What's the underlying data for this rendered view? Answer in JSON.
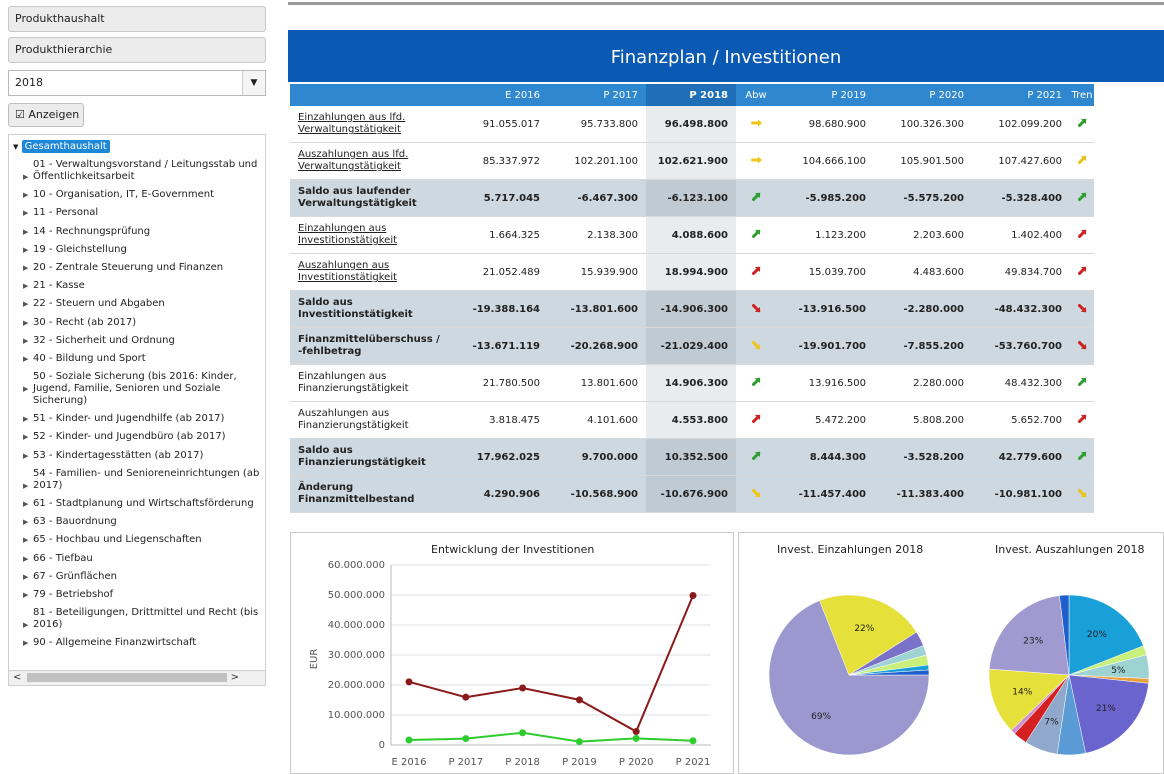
{
  "left": {
    "field1": "Produkthaushalt",
    "field2": "Produkthierarchie",
    "year": "2018",
    "year_arrow": "▼",
    "anzeigen_icon": "☑",
    "anzeigen_label": "Anzeigen",
    "tree_root": "Gesamthaushalt",
    "tree_items": [
      "01 - Verwaltungsvorstand / Leitungsstab und Öffentlichkeitsarbeit",
      "10 - Organisation, IT, E-Government",
      "11 - Personal",
      "14 - Rechnungsprüfung",
      "19 - Gleichstellung",
      "20 - Zentrale Steuerung und Finanzen",
      "21 - Kasse",
      "22 - Steuern und Abgaben",
      "30 - Recht (ab 2017)",
      "32 - Sicherheit und Ordnung",
      "40 - Bildung und Sport",
      "50 - Soziale Sicherung (bis 2016: Kinder, Jugend, Familie, Senioren und Soziale Sicherung)",
      "51 - Kinder- und Jugendhilfe (ab 2017)",
      "52 - Kinder- und Jugendbüro (ab 2017)",
      "53 - Kindertagesstätten (ab 2017)",
      "54 - Familien- und Senioreneinrichtungen (ab 2017)",
      "61 - Stadtplanung und Wirtschaftsförderung",
      "63 - Bauordnung",
      "65 - Hochbau und Liegenschaften",
      "66 - Tiefbau",
      "67 - Grünflächen",
      "79 - Betriebshof",
      "81 - Beteiligungen, Drittmittel und Recht (bis 2016)",
      "90 - Allgemeine Finanzwirtschaft"
    ]
  },
  "header": {
    "title": "Finanzplan / Investitionen"
  },
  "table": {
    "columns": [
      "",
      "E 2016",
      "P 2017",
      "P 2018",
      "Abw",
      "P 2019",
      "P 2020",
      "P 2021",
      "Tren"
    ],
    "rows": [
      {
        "label": "Einzahlungen aus lfd. Verwaltungstätigkeit",
        "link": true,
        "grey": false,
        "values": [
          "91.055.017",
          "95.733.800",
          "96.498.800",
          "98.680.900",
          "100.326.300",
          "102.099.200"
        ],
        "abw": "right",
        "abw_color": "#f0c419",
        "trend_color": "#2e9e2e"
      },
      {
        "label": "Auszahlungen aus lfd. Verwaltungstätigkeit",
        "link": true,
        "grey": false,
        "values": [
          "85.337.972",
          "102.201.100",
          "102.621.900",
          "104.666.100",
          "105.901.500",
          "107.427.600"
        ],
        "abw": "right",
        "abw_color": "#f0c419",
        "trend_color": "#e8c21a"
      },
      {
        "label": "Saldo aus laufender Verwaltungstätigkeit",
        "link": false,
        "grey": true,
        "values": [
          "5.717.045",
          "-6.467.300",
          "-6.123.100",
          "-5.985.200",
          "-5.575.200",
          "-5.328.400"
        ],
        "abw": "up",
        "abw_color": "#2e9e2e",
        "trend_color": "#2e9e2e"
      },
      {
        "label": "Einzahlungen aus Investitionstätigkeit",
        "link": true,
        "grey": false,
        "values": [
          "1.664.325",
          "2.138.300",
          "4.088.600",
          "1.123.200",
          "2.203.600",
          "1.402.400"
        ],
        "abw": "up",
        "abw_color": "#2e9e2e",
        "trend_color": "#cc2222"
      },
      {
        "label": "Auszahlungen aus Investitionstätigkeit",
        "link": true,
        "grey": false,
        "values": [
          "21.052.489",
          "15.939.900",
          "18.994.900",
          "15.039.700",
          "4.483.600",
          "49.834.700"
        ],
        "abw": "up",
        "abw_color": "#cc2222",
        "trend_color": "#cc2222"
      },
      {
        "label": "Saldo aus Investitionstätigkeit",
        "link": false,
        "grey": true,
        "values": [
          "-19.388.164",
          "-13.801.600",
          "-14.906.300",
          "-13.916.500",
          "-2.280.000",
          "-48.432.300"
        ],
        "abw": "down",
        "abw_color": "#cc2222",
        "trend_color": "#cc2222"
      },
      {
        "label": "Finanzmittelüberschuss / -fehlbetrag",
        "link": false,
        "grey": true,
        "values": [
          "-13.671.119",
          "-20.268.900",
          "-21.029.400",
          "-19.901.700",
          "-7.855.200",
          "-53.760.700"
        ],
        "abw": "down",
        "abw_color": "#f0c419",
        "trend_color": "#cc2222"
      },
      {
        "label": "Einzahlungen aus Finanzierungstätigkeit",
        "link": false,
        "grey": false,
        "values": [
          "21.780.500",
          "13.801.600",
          "14.906.300",
          "13.916.500",
          "2.280.000",
          "48.432.300"
        ],
        "abw": "up",
        "abw_color": "#2e9e2e",
        "trend_color": "#2e9e2e"
      },
      {
        "label": "Auszahlungen aus Finanzierungstätigkeit",
        "link": false,
        "grey": false,
        "values": [
          "3.818.475",
          "4.101.600",
          "4.553.800",
          "5.472.200",
          "5.808.200",
          "5.652.700"
        ],
        "abw": "up",
        "abw_color": "#cc2222",
        "trend_color": "#cc2222"
      },
      {
        "label": "Saldo aus Finanzierungstätigkeit",
        "link": false,
        "grey": true,
        "values": [
          "17.962.025",
          "9.700.000",
          "10.352.500",
          "8.444.300",
          "-3.528.200",
          "42.779.600"
        ],
        "abw": "up",
        "abw_color": "#2e9e2e",
        "trend_color": "#2e9e2e"
      },
      {
        "label": "Änderung Finanzmittelbestand",
        "link": false,
        "grey": true,
        "values": [
          "4.290.906",
          "-10.568.900",
          "-10.676.900",
          "-11.457.400",
          "-11.383.400",
          "-10.981.100"
        ],
        "abw": "down",
        "abw_color": "#f0c419",
        "trend_color": "#e8c21a"
      }
    ]
  },
  "chart_data": [
    {
      "type": "line",
      "title": "Entwicklung der Investitionen",
      "xlabel": "",
      "ylabel": "EUR",
      "ylim": [
        0,
        60000000
      ],
      "yticks": [
        "0",
        "10.000.000",
        "20.000.000",
        "30.000.000",
        "40.000.000",
        "50.000.000",
        "60.000.000"
      ],
      "categories": [
        "E 2016",
        "P 2017",
        "P 2018",
        "P 2019",
        "P 2020",
        "P 2021"
      ],
      "series": [
        {
          "color": "#8b1a1a",
          "values": [
            21052489,
            15939900,
            18994900,
            15039700,
            4483600,
            49834700
          ]
        },
        {
          "color": "#2ecc2e",
          "values": [
            1664325,
            2138300,
            4088600,
            1123200,
            2203600,
            1402400
          ]
        }
      ]
    },
    {
      "type": "pie",
      "title": "Invest. Einzahlungen 2018",
      "slices": [
        {
          "value": 69,
          "label": "69%",
          "color": "#9b98cf"
        },
        {
          "value": 22,
          "label": "22%",
          "color": "#e6e03a"
        },
        {
          "value": 3,
          "label": "",
          "color": "#7a72c8"
        },
        {
          "value": 2,
          "label": "",
          "color": "#9ed3d3"
        },
        {
          "value": 2,
          "label": "",
          "color": "#c8f07a"
        },
        {
          "value": 1,
          "label": "",
          "color": "#1aa0d8"
        },
        {
          "value": 1,
          "label": "",
          "color": "#1f5fcc"
        }
      ]
    },
    {
      "type": "pie",
      "title": "Invest. Auszahlungen 2018",
      "slices": [
        {
          "value": 20,
          "label": "20%",
          "color": "#1aa0d8"
        },
        {
          "value": 2,
          "label": "",
          "color": "#c8f07a"
        },
        {
          "value": 5,
          "label": "5%",
          "color": "#9ed3d3"
        },
        {
          "value": 1,
          "label": "",
          "color": "#e8a040"
        },
        {
          "value": 21,
          "label": "21%",
          "color": "#6a64cf"
        },
        {
          "value": 6,
          "label": "",
          "color": "#5b9bd5"
        },
        {
          "value": 7,
          "label": "7%",
          "color": "#8fa8cc"
        },
        {
          "value": 3,
          "label": "",
          "color": "#d42020"
        },
        {
          "value": 1,
          "label": "",
          "color": "#d090d0"
        },
        {
          "value": 14,
          "label": "14%",
          "color": "#e6e03a"
        },
        {
          "value": 23,
          "label": "23%",
          "color": "#a09ad0"
        },
        {
          "value": 2,
          "label": "",
          "color": "#1f5fcc"
        }
      ]
    }
  ]
}
